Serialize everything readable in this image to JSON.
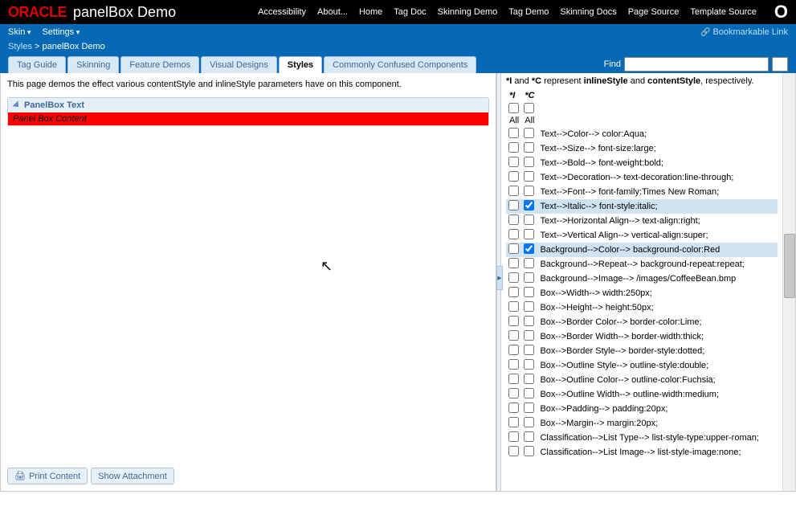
{
  "header": {
    "logo": "ORACLE",
    "title": "panelBox Demo",
    "nav": [
      "Accessibility",
      "About...",
      "Home",
      "Tag Doc",
      "Skinning Demo",
      "Tag Demo",
      "Skinning Docs",
      "Page Source",
      "Template Source"
    ],
    "oracle_o": "O"
  },
  "bluebar": {
    "skin": "Skin",
    "settings": "Settings",
    "bookmark": "Bookmarkable Link"
  },
  "breadcrumb": {
    "root": "Styles",
    "sep": " > ",
    "current": "panelBox Demo"
  },
  "tabs": {
    "items": [
      "Tag Guide",
      "Skinning",
      "Feature Demos",
      "Visual Designs",
      "Styles",
      "Commonly Confused Components"
    ],
    "active": 4,
    "find_label": "Find",
    "find_value": "",
    "go": "→"
  },
  "left": {
    "intro": "This page demos the effect various contentStyle and inlineStyle parameters have on this component.",
    "panel_title": "PanelBox Text",
    "panel_content": "Panel Box Content",
    "print": "Print Content",
    "show": "Show Attachment"
  },
  "right": {
    "legend_i": "*I",
    "legend_and": " and ",
    "legend_c": "*C",
    "legend_rep": " represent ",
    "legend_inline": "inlineStyle",
    "legend_and2": " and ",
    "legend_content": "contentStyle",
    "legend_end": ", respectively.",
    "col_i": "*I",
    "col_c": "*C",
    "all": "All",
    "rows": [
      {
        "i": false,
        "c": false,
        "sel": false,
        "label": "Text-->Color--> color:Aqua;"
      },
      {
        "i": false,
        "c": false,
        "sel": false,
        "label": "Text-->Size--> font-size:large;"
      },
      {
        "i": false,
        "c": false,
        "sel": false,
        "label": "Text-->Bold--> font-weight:bold;"
      },
      {
        "i": false,
        "c": false,
        "sel": false,
        "label": "Text-->Decoration--> text-decoration:line-through;"
      },
      {
        "i": false,
        "c": false,
        "sel": false,
        "label": "Text-->Font--> font-family:Times New Roman;"
      },
      {
        "i": false,
        "c": true,
        "sel": true,
        "label": "Text-->Italic--> font-style:italic;"
      },
      {
        "i": false,
        "c": false,
        "sel": false,
        "label": "Text-->Horizontal Align--> text-align:right;"
      },
      {
        "i": false,
        "c": false,
        "sel": false,
        "label": "Text-->Vertical Align--> vertical-align:super;"
      },
      {
        "i": false,
        "c": true,
        "sel": true,
        "label": "Background-->Color--> background-color:Red"
      },
      {
        "i": false,
        "c": false,
        "sel": false,
        "label": "Background-->Repeat--> background-repeat:repeat;"
      },
      {
        "i": false,
        "c": false,
        "sel": false,
        "label": "Background-->Image--> /images/CoffeeBean.bmp"
      },
      {
        "i": false,
        "c": false,
        "sel": false,
        "label": "Box-->Width--> width:250px;"
      },
      {
        "i": false,
        "c": false,
        "sel": false,
        "label": "Box-->Height--> height:50px;"
      },
      {
        "i": false,
        "c": false,
        "sel": false,
        "label": "Box-->Border Color--> border-color:Lime;"
      },
      {
        "i": false,
        "c": false,
        "sel": false,
        "label": "Box-->Border Width--> border-width:thick;"
      },
      {
        "i": false,
        "c": false,
        "sel": false,
        "label": "Box-->Border Style--> border-style:dotted;"
      },
      {
        "i": false,
        "c": false,
        "sel": false,
        "label": "Box-->Outline Style--> outline-style:double;"
      },
      {
        "i": false,
        "c": false,
        "sel": false,
        "label": "Box-->Outline Color--> outline-color:Fuchsia;"
      },
      {
        "i": false,
        "c": false,
        "sel": false,
        "label": "Box-->Outline Width--> outline-width:medium;"
      },
      {
        "i": false,
        "c": false,
        "sel": false,
        "label": "Box-->Padding--> padding:20px;"
      },
      {
        "i": false,
        "c": false,
        "sel": false,
        "label": "Box-->Margin--> margin:20px;"
      },
      {
        "i": false,
        "c": false,
        "sel": false,
        "label": "Classification-->List Type--> list-style-type:upper-roman;"
      },
      {
        "i": false,
        "c": false,
        "sel": false,
        "label": "Classification-->List Image--> list-style-image:none;"
      }
    ]
  }
}
